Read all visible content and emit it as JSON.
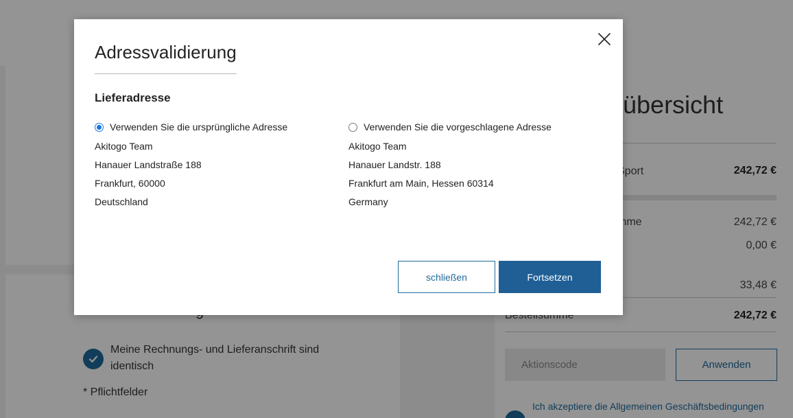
{
  "background": {
    "section_title_fragment": "g",
    "same_address_label": "Meine Rechnungs- und Lieferanschrift sind identisch",
    "required_note": "* Pflichtfelder",
    "summary": {
      "title_fragment": "lübersicht",
      "item_label_fragment": "Sport",
      "item_price": "242,72 €",
      "subtotal_label_fragment": "mme",
      "subtotal_value": "242,72 €",
      "shipping_value": "0,00 €",
      "tax_value": "33,48 €",
      "total_label": "Bestellsumme",
      "total_value": "242,72 €",
      "promo_placeholder": "Aktionscode",
      "apply_label": "Anwenden",
      "terms_text": "Ich akzeptiere die Allgemeinen Geschäftsbedingungen"
    }
  },
  "modal": {
    "title": "Adressvalidierung",
    "section_heading": "Lieferadresse",
    "original": {
      "option_label": "Verwenden Sie die ursprüngliche Adresse",
      "selected": true,
      "lines": [
        "Akitogo Team",
        "Hanauer Landstraße 188",
        "Frankfurt, 60000",
        "Deutschland"
      ]
    },
    "suggested": {
      "option_label": "Verwenden Sie die vorgeschlagene Adresse",
      "selected": false,
      "lines": [
        "Akitogo Team",
        "Hanauer Landstr. 188",
        "Frankfurt am Main, Hessen 60314",
        "Germany"
      ]
    },
    "close_button_label": "schließen",
    "continue_button_label": "Fortsetzen",
    "close_icon": "close-icon"
  },
  "colors": {
    "accent": "#1f6a9c",
    "primary_button": "#1f5f96",
    "radio_selected": "#1a73e8",
    "overlay": "rgba(0,0,0,0.42)"
  }
}
